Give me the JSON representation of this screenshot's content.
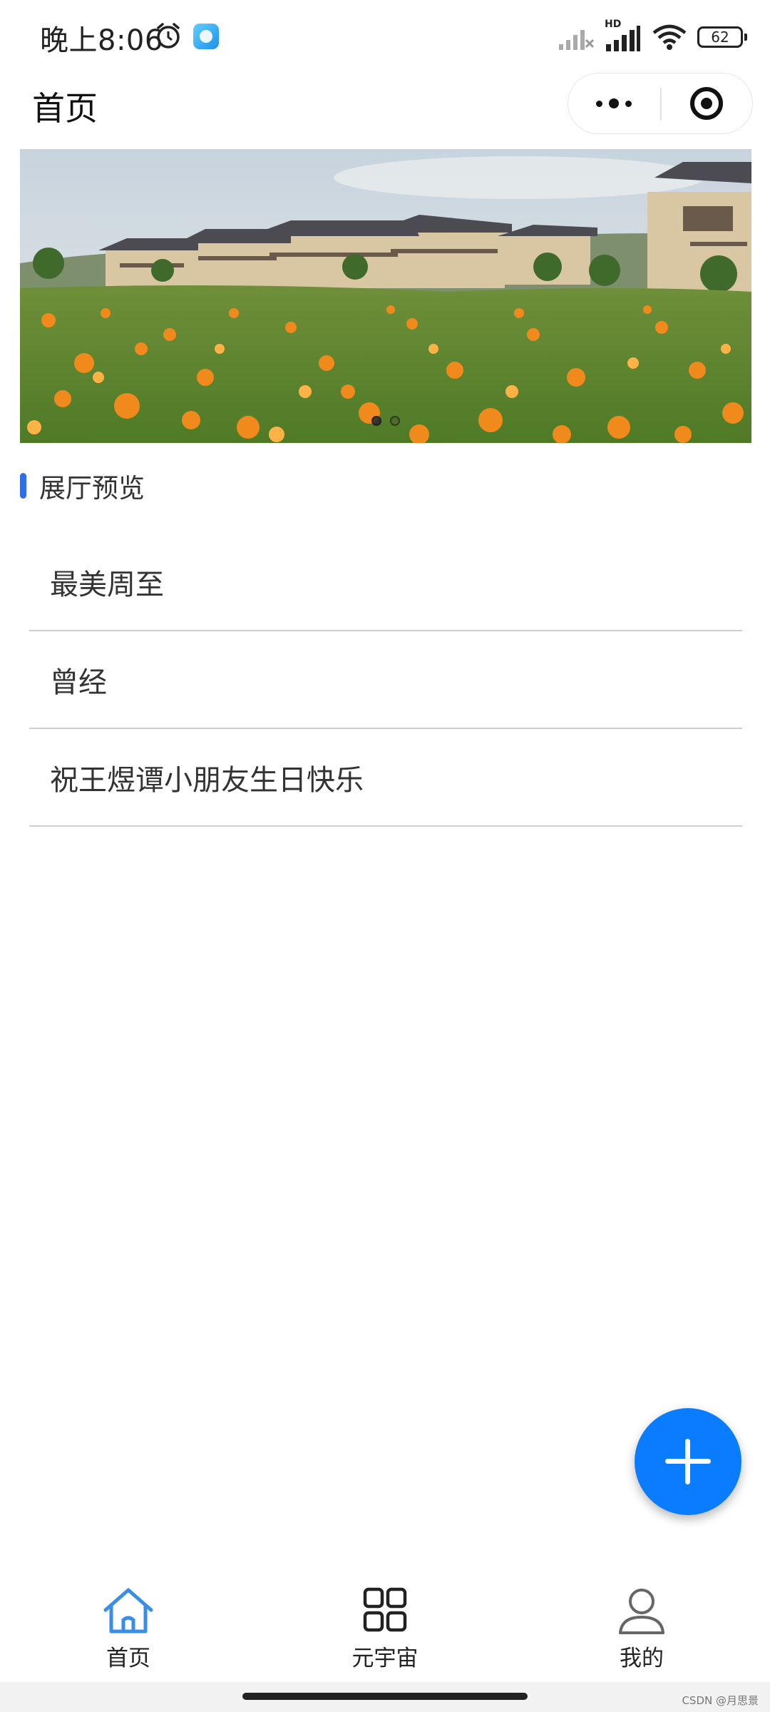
{
  "status_bar": {
    "time": "晚上8:06",
    "network_label": "HD",
    "battery": "62"
  },
  "nav": {
    "title": "首页"
  },
  "banner": {
    "slide_count": 2,
    "active_index": 0
  },
  "section": {
    "title": "展厅预览"
  },
  "gallery_items": [
    {
      "label": "最美周至"
    },
    {
      "label": "曾经"
    },
    {
      "label": "祝王煜谭小朋友生日快乐"
    }
  ],
  "tabbar": {
    "items": [
      {
        "label": "首页",
        "icon": "home-icon",
        "active": true
      },
      {
        "label": "元宇宙",
        "icon": "grid-icon",
        "active": false
      },
      {
        "label": "我的",
        "icon": "user-icon",
        "active": false
      }
    ]
  },
  "watermark": "CSDN @月思景",
  "colors": {
    "accent": "#2f6fe6",
    "fab": "#0a7cff",
    "tab_active": "#3a8ee6"
  }
}
